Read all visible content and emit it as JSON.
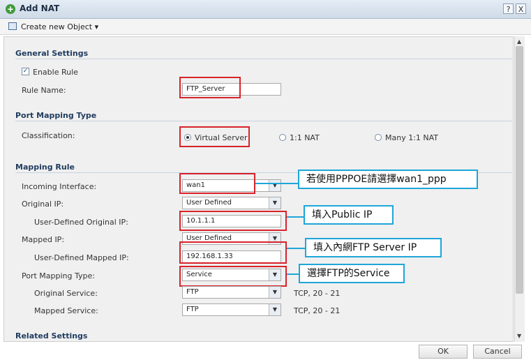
{
  "window": {
    "title": "Add NAT",
    "help": "?",
    "close": "X"
  },
  "toolbar": {
    "create_object": "Create new Object",
    "caret": "▾"
  },
  "general": {
    "heading": "General Settings",
    "enable_rule": "Enable Rule",
    "enable_checked": "✓",
    "rule_name_label": "Rule Name:",
    "rule_name_value": "FTP_Server"
  },
  "port_mapping_type": {
    "heading": "Port Mapping Type",
    "classification_label": "Classification:",
    "options": [
      "Virtual Server",
      "1:1 NAT",
      "Many 1:1 NAT"
    ],
    "selected": "Virtual Server"
  },
  "mapping_rule": {
    "heading": "Mapping Rule",
    "incoming_interface_label": "Incoming Interface:",
    "incoming_interface_value": "wan1",
    "original_ip_label": "Original IP:",
    "original_ip_value": "User Defined",
    "user_defined_original_ip_label": "User-Defined Original IP:",
    "user_defined_original_ip_value": "10.1.1.1",
    "mapped_ip_label": "Mapped IP:",
    "mapped_ip_value": "User Defined",
    "user_defined_mapped_ip_label": "User-Defined Mapped IP:",
    "user_defined_mapped_ip_value": "192.168.1.33",
    "port_mapping_type_label": "Port Mapping Type:",
    "port_mapping_type_value": "Service",
    "original_service_label": "Original Service:",
    "original_service_value": "FTP",
    "original_service_info": "TCP, 20 - 21",
    "mapped_service_label": "Mapped Service:",
    "mapped_service_value": "FTP",
    "mapped_service_info": "TCP, 20 - 21"
  },
  "related": {
    "heading": "Related Settings"
  },
  "callouts": {
    "pppoe": "若使用PPPOE請選擇wan1_ppp",
    "public_ip": "填入Public IP",
    "lan_ip": "填入內網FTP Server IP",
    "service": "選擇FTP的Service"
  },
  "buttons": {
    "ok": "OK",
    "cancel": "Cancel"
  },
  "colors": {
    "highlight": "#d8232a",
    "callout": "#1ea6d9",
    "section": "#1f3b5f"
  }
}
